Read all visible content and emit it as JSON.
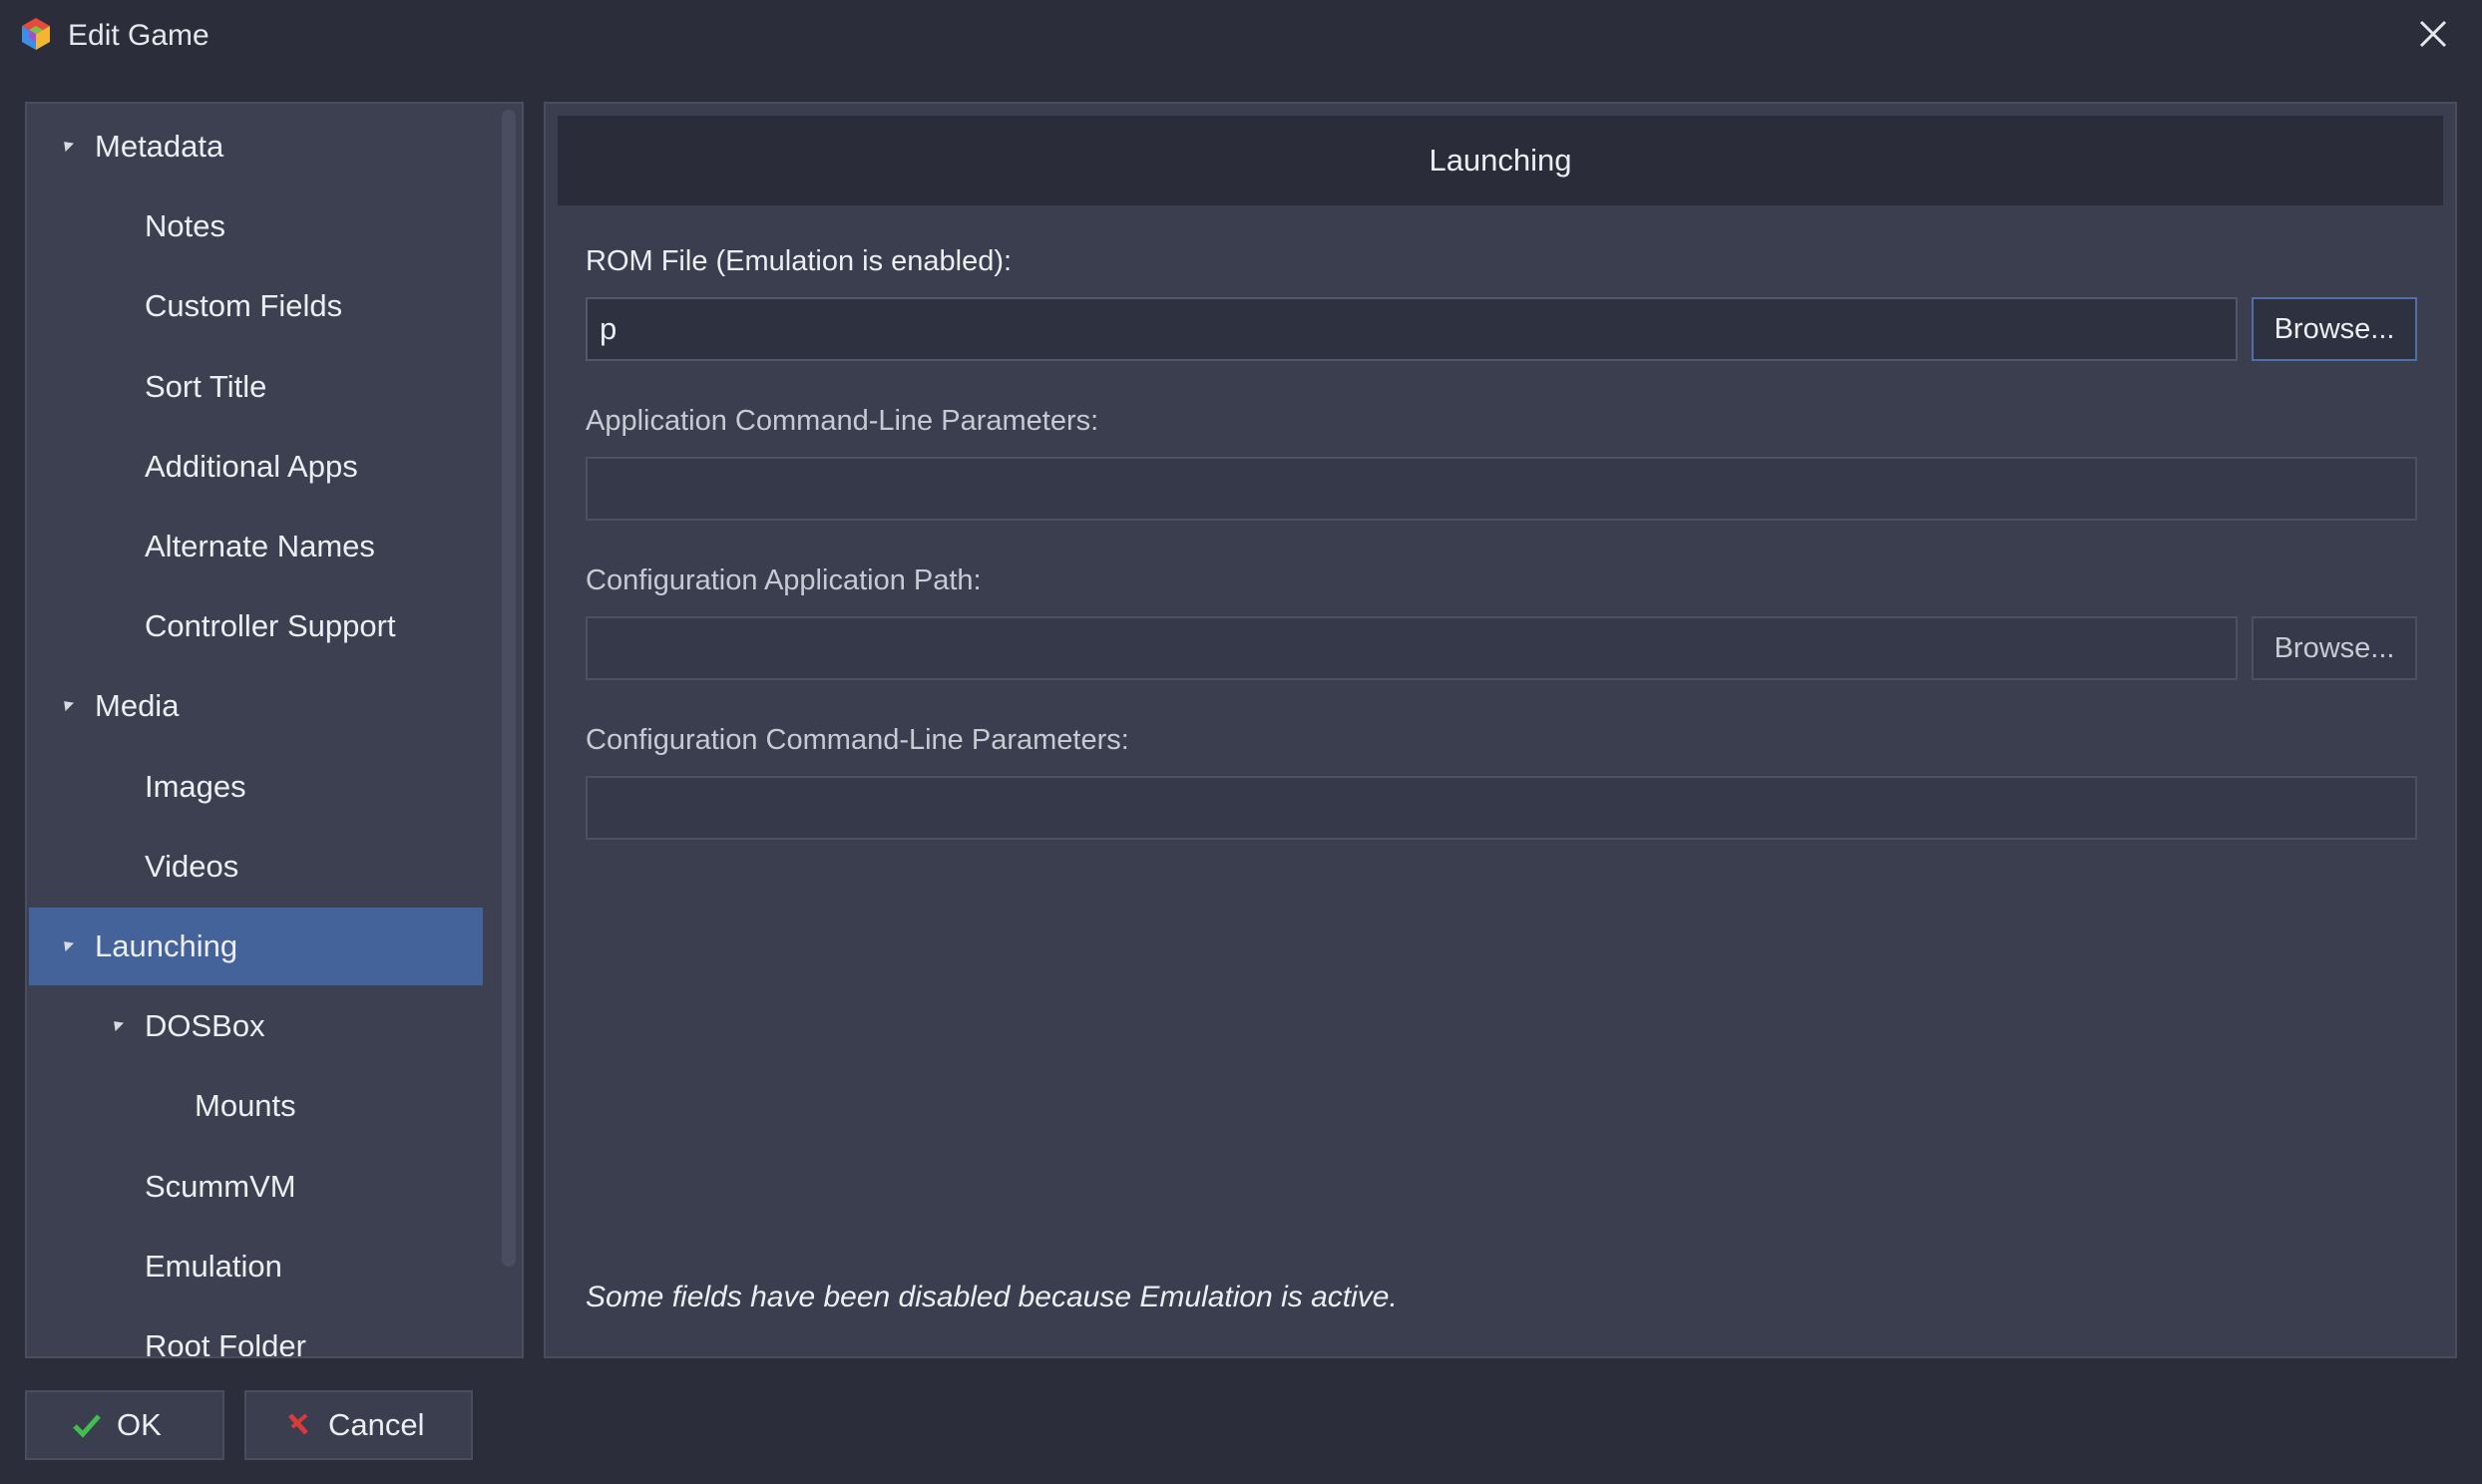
{
  "window": {
    "title": "Edit Game",
    "app_icon": "launchbox-cube-icon",
    "close_icon": "close-icon"
  },
  "sidebar": {
    "items": [
      {
        "label": "Metadata",
        "level": 0,
        "expandable": true,
        "selected": false
      },
      {
        "label": "Notes",
        "level": 1,
        "expandable": false,
        "selected": false
      },
      {
        "label": "Custom Fields",
        "level": 1,
        "expandable": false,
        "selected": false
      },
      {
        "label": "Sort Title",
        "level": 1,
        "expandable": false,
        "selected": false
      },
      {
        "label": "Additional Apps",
        "level": 1,
        "expandable": false,
        "selected": false
      },
      {
        "label": "Alternate Names",
        "level": 1,
        "expandable": false,
        "selected": false
      },
      {
        "label": "Controller Support",
        "level": 1,
        "expandable": false,
        "selected": false
      },
      {
        "label": "Media",
        "level": 0,
        "expandable": true,
        "selected": false
      },
      {
        "label": "Images",
        "level": 1,
        "expandable": false,
        "selected": false
      },
      {
        "label": "Videos",
        "level": 1,
        "expandable": false,
        "selected": false
      },
      {
        "label": "Launching",
        "level": 0,
        "expandable": true,
        "selected": true
      },
      {
        "label": "DOSBox",
        "level": 1,
        "expandable": true,
        "selected": false
      },
      {
        "label": "Mounts",
        "level": 2,
        "expandable": false,
        "selected": false
      },
      {
        "label": "ScummVM",
        "level": 1,
        "expandable": false,
        "selected": false
      },
      {
        "label": "Emulation",
        "level": 1,
        "expandable": false,
        "selected": false
      },
      {
        "label": "Root Folder",
        "level": 1,
        "expandable": false,
        "selected": false
      }
    ]
  },
  "main": {
    "header": "Launching",
    "rom_file": {
      "label": "ROM File (Emulation is enabled):",
      "value": "p",
      "browse_label": "Browse..."
    },
    "app_params": {
      "label": "Application Command-Line Parameters:",
      "value": ""
    },
    "config_path": {
      "label": "Configuration Application Path:",
      "value": "",
      "browse_label": "Browse..."
    },
    "config_params": {
      "label": "Configuration Command-Line Parameters:",
      "value": ""
    },
    "footer_note": "Some fields have been disabled because Emulation is active."
  },
  "buttons": {
    "ok_label": "OK",
    "ok_icon": "checkmark-icon",
    "cancel_label": "Cancel",
    "cancel_icon": "red-x-icon"
  },
  "colors": {
    "background": "#2b2d3a",
    "panel": "#3b3e4f",
    "selected": "#44639a",
    "ok_check": "#3fbf4f",
    "cancel_x": "#d93a3a"
  }
}
